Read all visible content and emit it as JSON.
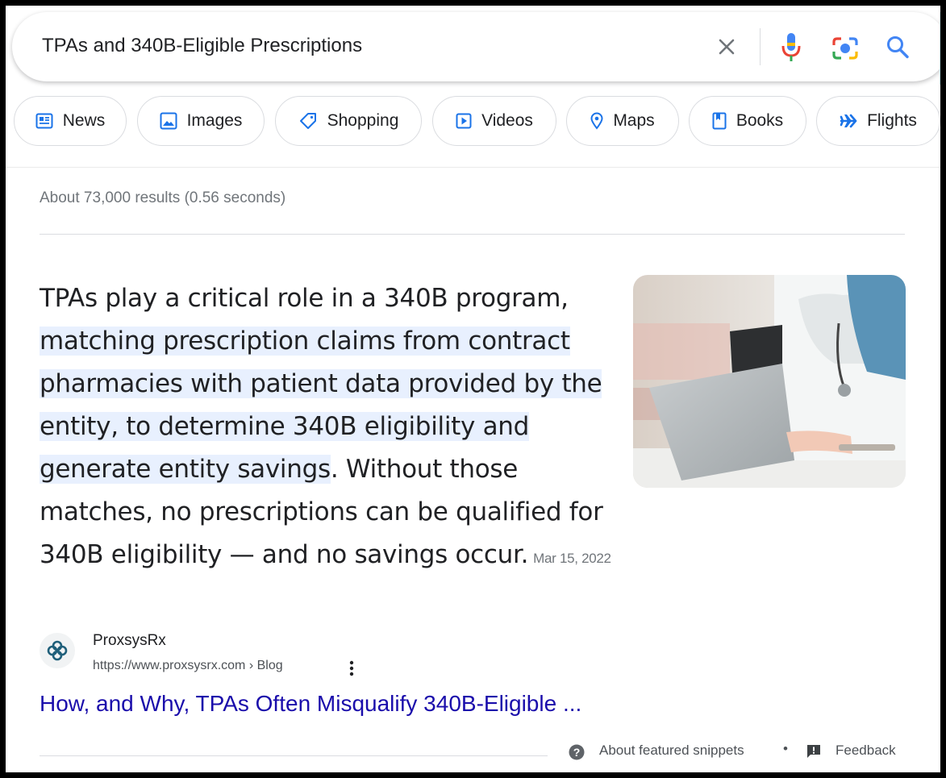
{
  "search": {
    "query": "TPAs and 340B-Eligible Prescriptions"
  },
  "chips": [
    {
      "label": "News",
      "icon": "news-icon"
    },
    {
      "label": "Images",
      "icon": "image-icon"
    },
    {
      "label": "Shopping",
      "icon": "tag-icon"
    },
    {
      "label": "Videos",
      "icon": "play-icon"
    },
    {
      "label": "Maps",
      "icon": "map-pin-icon"
    },
    {
      "label": "Books",
      "icon": "book-icon"
    },
    {
      "label": "Flights",
      "icon": "plane-icon"
    }
  ],
  "results": {
    "stats": "About 73,000 results (0.56 seconds)"
  },
  "snippet": {
    "lead": "TPAs play a critical role in a 340B program, ",
    "highlight": "matching prescription claims from contract pharmacies with patient data provided by the entity, to determine 340B eligibility and generate entity savings",
    "rest": ". Without those matches, no prescriptions can be qualified for 340B eligibility — and no savings occur.",
    "date": "Mar 15, 2022"
  },
  "source": {
    "name": "ProxsysRx",
    "url": "https://www.proxsysrx.com › Blog",
    "title": "How, and Why, TPAs Often Misqualify 340B-Eligible ..."
  },
  "footer": {
    "about": "About featured snippets",
    "dot": "•",
    "feedback": "Feedback"
  },
  "colors": {
    "link": "#1a0dab",
    "highlight": "#e8f0fe",
    "google_blue": "#4285f4",
    "google_red": "#ea4335",
    "google_yellow": "#fbbc04",
    "google_green": "#34a853",
    "brand_teal": "#1f5f7a"
  }
}
